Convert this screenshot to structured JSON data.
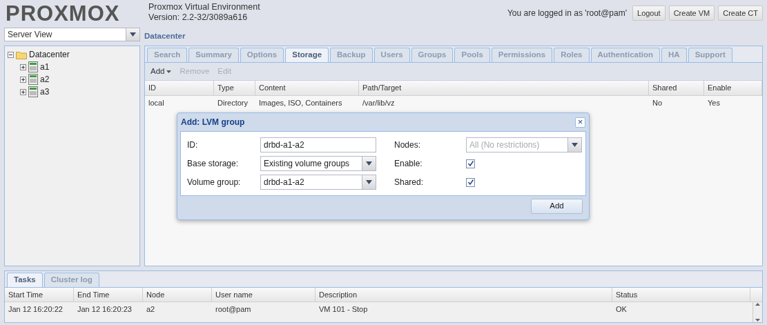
{
  "header": {
    "logo": "PROXMOX",
    "product": "Proxmox Virtual Environment",
    "version": "Version: 2.2-32/3089a616",
    "login_text": "You are logged in as 'root@pam'",
    "buttons": [
      "Logout",
      "Create VM",
      "Create CT"
    ]
  },
  "view_selector": {
    "value": "Server View"
  },
  "tree": [
    {
      "label": "Datacenter",
      "kind": "folder",
      "expanded": true,
      "children": [
        {
          "label": "a1",
          "kind": "node",
          "expanded": false
        },
        {
          "label": "a2",
          "kind": "node",
          "expanded": false
        },
        {
          "label": "a3",
          "kind": "node",
          "expanded": false
        }
      ]
    }
  ],
  "content_title": "Datacenter",
  "tabs": [
    {
      "label": "Search",
      "selected": false
    },
    {
      "label": "Summary",
      "selected": false
    },
    {
      "label": "Options",
      "selected": false
    },
    {
      "label": "Storage",
      "selected": true
    },
    {
      "label": "Backup",
      "selected": false
    },
    {
      "label": "Users",
      "selected": false
    },
    {
      "label": "Groups",
      "selected": false
    },
    {
      "label": "Pools",
      "selected": false
    },
    {
      "label": "Permissions",
      "selected": false
    },
    {
      "label": "Roles",
      "selected": false
    },
    {
      "label": "Authentication",
      "selected": false
    },
    {
      "label": "HA",
      "selected": false
    },
    {
      "label": "Support",
      "selected": false
    }
  ],
  "toolbar": [
    {
      "label": "Add",
      "disabled": false,
      "menu": true
    },
    {
      "label": "Remove",
      "disabled": true,
      "menu": false
    },
    {
      "label": "Edit",
      "disabled": true,
      "menu": false
    }
  ],
  "storage_table": {
    "columns": [
      "ID",
      "Type",
      "Content",
      "Path/Target",
      "Shared",
      "Enable"
    ],
    "rows": [
      [
        "local",
        "Directory",
        "Images, ISO, Containers",
        "/var/lib/vz",
        "No",
        "Yes"
      ]
    ]
  },
  "dialog": {
    "title": "Add: LVM group",
    "close": "×",
    "left_fields": [
      {
        "label": "ID:",
        "value": "drbd-a1-a2",
        "kind": "text"
      },
      {
        "label": "Base storage:",
        "value": "Existing volume groups",
        "kind": "combo"
      },
      {
        "label": "Volume group:",
        "value": "drbd-a1-a2",
        "kind": "combo"
      }
    ],
    "right_fields": [
      {
        "label": "Nodes:",
        "placeholder": "All (No restrictions)",
        "kind": "combo"
      },
      {
        "label": "Enable:",
        "checked": true,
        "kind": "checkbox"
      },
      {
        "label": "Shared:",
        "checked": true,
        "kind": "checkbox"
      }
    ],
    "button": "Add"
  },
  "bottom_tabs": [
    {
      "label": "Tasks",
      "selected": true
    },
    {
      "label": "Cluster log",
      "selected": false
    }
  ],
  "tasks_table": {
    "columns": [
      "Start Time",
      "End Time",
      "Node",
      "User name",
      "Description",
      "Status"
    ],
    "rows": [
      [
        "Jan 12 16:20:22",
        "Jan 12 16:20:23",
        "a2",
        "root@pam",
        "VM 101 - Stop",
        "OK"
      ]
    ]
  }
}
